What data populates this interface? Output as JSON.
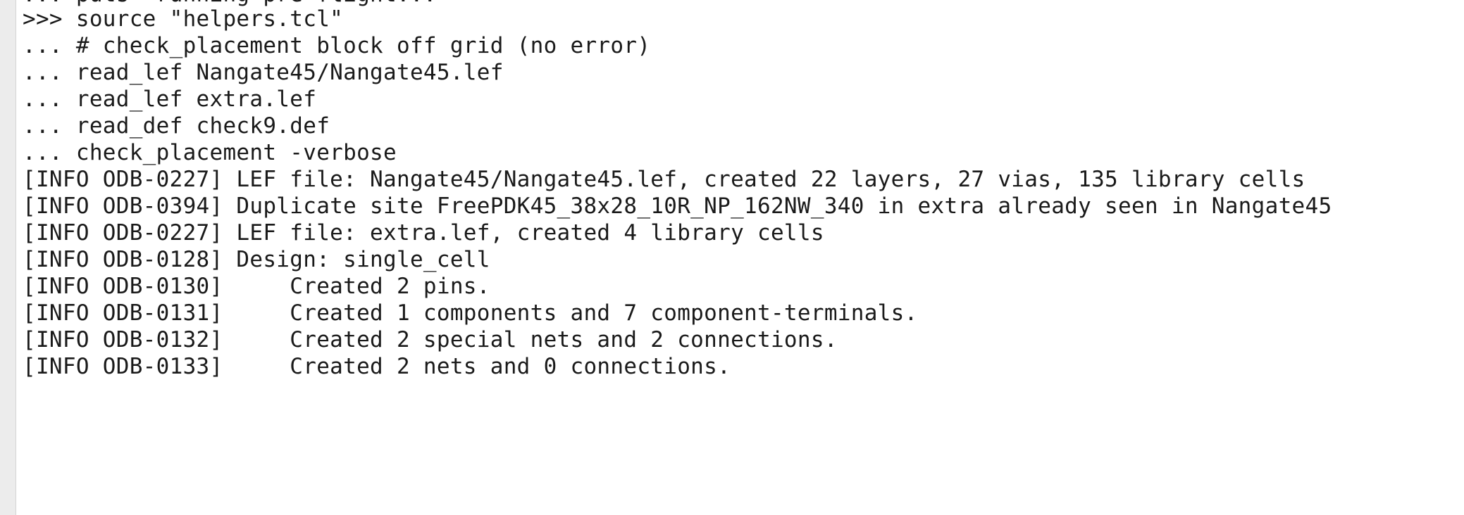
{
  "console": {
    "partial_top_line": "... puts \"running pre-flight...\"",
    "lines": [
      ">>> source \"helpers.tcl\"",
      "... # check_placement block off grid (no error)",
      "... read_lef Nangate45/Nangate45.lef",
      "... read_lef extra.lef",
      "... read_def check9.def",
      "... check_placement -verbose",
      "[INFO ODB-0227] LEF file: Nangate45/Nangate45.lef, created 22 layers, 27 vias, 135 library cells",
      "[INFO ODB-0394] Duplicate site FreePDK45_38x28_10R_NP_162NW_340 in extra already seen in Nangate45",
      "[INFO ODB-0227] LEF file: extra.lef, created 4 library cells",
      "[INFO ODB-0128] Design: single_cell",
      "[INFO ODB-0130]     Created 2 pins.",
      "[INFO ODB-0131]     Created 1 components and 7 component-terminals.",
      "[INFO ODB-0132]     Created 2 special nets and 2 connections.",
      "[INFO ODB-0133]     Created 2 nets and 0 connections."
    ]
  }
}
